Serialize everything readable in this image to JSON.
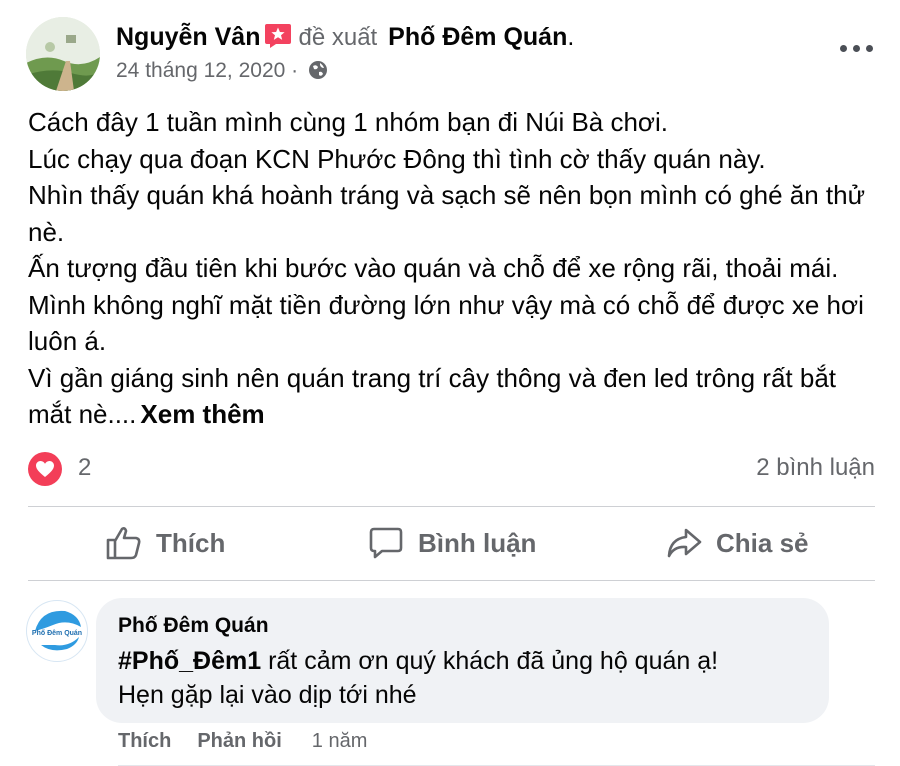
{
  "post": {
    "author": "Nguyễn Vân",
    "recommends_text": "đề xuất",
    "page_name": "Phố Đêm Quán",
    "period": ".",
    "date": "24 tháng 12, 2020 ·",
    "body_lines": [
      "Cách đây 1 tuần mình cùng 1 nhóm bạn đi Núi Bà chơi.",
      "Lúc chạy qua đoạn KCN Phước Đông thì tình cờ thấy quán này.",
      "Nhìn thấy quán khá hoành tráng và sạch sẽ nên bọn mình có ghé ăn thử nè.",
      "Ấn tượng đầu tiên khi bước vào quán và chỗ để xe rộng rãi, thoải mái.",
      "Mình không nghĩ mặt tiền đường lớn như vậy mà có chỗ để được xe hơi luôn á.",
      "Vì gần giáng sinh nên quán trang trí cây thông và đen led trông rất bắt mắt nè...."
    ],
    "see_more": "Xem thêm",
    "reaction_count": "2",
    "comment_count": "2 bình luận"
  },
  "actions": {
    "like": "Thích",
    "comment": "Bình luận",
    "share": "Chia sẻ"
  },
  "comment": {
    "author": "Phố Đêm Quán",
    "hashtag": "#Phố_Đêm1",
    "text_line1": " rất cảm ơn quý khách đã ủng hộ quán ạ!",
    "text_line2": "Hẹn gặp lại vào dịp tới nhé",
    "like": "Thích",
    "reply": "Phản hồi",
    "time": "1 năm",
    "avatar_logo_text": "Phố Đêm Quán"
  },
  "icons": {
    "badge": "recommend-star-icon",
    "privacy": "globe-icon",
    "more": "more-options-icon",
    "reaction": "love-reaction-icon",
    "like": "thumbs-up-icon",
    "comment": "comment-bubble-icon",
    "share": "share-arrow-icon"
  },
  "colors": {
    "love": "#f33e58",
    "badge": "#f3425f",
    "secondary_text": "#65676b",
    "bubble_bg": "#f0f2f5"
  }
}
